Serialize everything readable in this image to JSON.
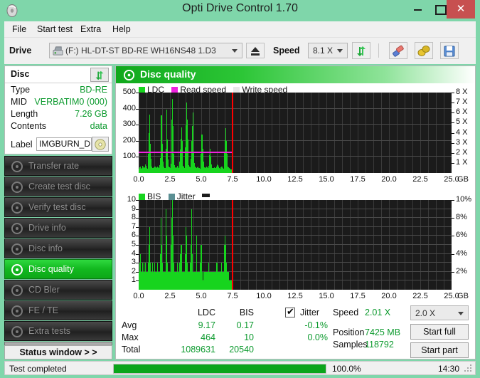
{
  "window": {
    "title": "Opti Drive Control 1.70",
    "icon": "disc-icon",
    "minimize_label": "–",
    "maximize_label": "☐",
    "close_label": "✕",
    "chrome_color": "#7fd6aa",
    "close_color": "#c75050"
  },
  "menu": {
    "items": [
      {
        "label": "File"
      },
      {
        "label": "Start test"
      },
      {
        "label": "Extra"
      },
      {
        "label": "Help"
      }
    ]
  },
  "toolbar": {
    "drive_label": "Drive",
    "drive_value": "(F:)  HL-DT-ST BD-RE  WH16NS48 1.D3",
    "drive_icon": "drive-icon",
    "eject_icon": "eject-icon",
    "speed_label": "Speed",
    "speed_value": "8.1 X",
    "refresh_icon": "refresh-icon",
    "eraser_icon": "eraser-icon",
    "bell_icon": "bell-icon",
    "save_icon": "save-icon"
  },
  "disc_panel": {
    "title": "Disc",
    "refresh_icon": "refresh-icon",
    "rows": [
      {
        "key": "Type",
        "value": "BD-RE"
      },
      {
        "key": "MID",
        "value": "VERBATIM0 (000)"
      },
      {
        "key": "Length",
        "value": "7.26 GB"
      },
      {
        "key": "Contents",
        "value": "data"
      }
    ],
    "label_key": "Label",
    "label_value": "IMGBURN_DIS",
    "label_icon": "disc-icon",
    "value_color": "#0c9a2e"
  },
  "nav": {
    "items": [
      {
        "label": "Transfer rate",
        "icon": "disc-test-icon",
        "active": false
      },
      {
        "label": "Create test disc",
        "icon": "disc-create-icon",
        "active": false
      },
      {
        "label": "Verify test disc",
        "icon": "disc-verify-icon",
        "active": false
      },
      {
        "label": "Drive info",
        "icon": "drive-info-icon",
        "active": false
      },
      {
        "label": "Disc info",
        "icon": "disc-info-icon",
        "active": false
      },
      {
        "label": "Disc quality",
        "icon": "disc-quality-icon",
        "active": true
      },
      {
        "label": "CD Bler",
        "icon": "disc-bler-icon",
        "active": false
      },
      {
        "label": "FE / TE",
        "icon": "disc-fete-icon",
        "active": false
      },
      {
        "label": "Extra tests",
        "icon": "disc-extra-icon",
        "active": false
      }
    ],
    "status_window_label": "Status window > >"
  },
  "main": {
    "title": "Disc quality",
    "title_icon": "disc-quality-icon"
  },
  "chart_data": [
    {
      "type": "bar",
      "name": "ldc-chart",
      "title": "",
      "xlabel": "GB",
      "ylabel": "LDC",
      "ylim": [
        0,
        500
      ],
      "yticks": [
        100,
        200,
        300,
        400,
        500
      ],
      "xlim": [
        0,
        25
      ],
      "xticks": [
        0.0,
        2.5,
        5.0,
        7.5,
        10.0,
        12.5,
        15.0,
        17.5,
        20.0,
        22.5,
        25.0
      ],
      "xticklabels": [
        "0.0",
        "2.5",
        "5.0",
        "7.5",
        "10.0",
        "12.5",
        "15.0",
        "17.5",
        "20.0",
        "22.5",
        "25.0"
      ],
      "x_unit_label": "GB",
      "y2label": "Speed",
      "y2lim": [
        0,
        8
      ],
      "y2ticks": [
        1,
        2,
        3,
        4,
        5,
        6,
        7,
        8
      ],
      "y2ticklabels": [
        "1 X",
        "2 X",
        "3 X",
        "4 X",
        "5 X",
        "6 X",
        "7 X",
        "8 X"
      ],
      "grid": true,
      "legend": [
        {
          "label": "LDC",
          "color": "#17d41e"
        },
        {
          "label": "Read speed",
          "color": "#ee22dd"
        },
        {
          "label": "Write speed",
          "color": "#e8e8e8"
        }
      ],
      "cursor_x": 7.42,
      "read_speed_level": 125,
      "data_end_x": 7.42,
      "values": [
        28,
        34,
        41,
        30,
        26,
        33,
        45,
        38,
        31,
        29,
        36,
        52,
        44,
        35,
        30,
        28,
        60,
        120,
        250,
        365,
        180,
        90,
        45,
        38,
        33,
        30,
        28,
        35,
        42,
        38,
        31,
        29,
        34,
        40,
        36,
        32,
        30,
        48,
        95,
        190,
        358,
        300,
        180,
        70,
        42,
        36,
        33,
        30,
        150,
        312,
        395,
        210,
        85,
        40,
        35,
        32,
        30,
        58,
        170,
        330,
        462,
        290,
        120,
        50,
        38,
        34,
        31,
        29,
        35,
        44,
        38,
        33,
        30,
        70,
        145,
        212,
        285,
        200,
        95,
        45,
        38,
        33,
        30,
        160,
        295,
        438,
        330,
        210,
        110,
        48,
        40,
        35,
        31,
        90,
        198,
        290,
        377,
        240,
        130,
        60,
        42,
        36,
        32,
        30,
        35,
        40,
        36,
        33,
        30,
        28,
        44,
        120,
        238,
        240,
        150,
        70,
        40,
        35,
        31,
        29,
        34,
        38,
        35,
        31,
        28,
        45,
        110,
        152,
        100,
        55,
        38,
        33,
        30,
        28,
        32,
        36,
        33,
        30,
        28,
        40,
        55,
        48,
        38,
        33,
        30,
        28,
        35,
        42,
        38,
        33,
        30,
        28,
        50,
        130,
        205,
        278,
        200,
        120,
        55,
        40,
        35,
        30,
        28,
        26,
        24,
        20
      ]
    },
    {
      "type": "bar",
      "name": "bis-chart",
      "title": "",
      "xlabel": "GB",
      "ylabel": "BIS",
      "ylim": [
        0,
        10
      ],
      "yticks": [
        1,
        2,
        3,
        4,
        5,
        6,
        7,
        8,
        9,
        10
      ],
      "xlim": [
        0,
        25
      ],
      "xticks": [
        0.0,
        2.5,
        5.0,
        7.5,
        10.0,
        12.5,
        15.0,
        17.5,
        20.0,
        22.5,
        25.0
      ],
      "xticklabels": [
        "0.0",
        "2.5",
        "5.0",
        "7.5",
        "10.0",
        "12.5",
        "15.0",
        "17.5",
        "20.0",
        "22.5",
        "25.0"
      ],
      "x_unit_label": "GB",
      "y2label": "Jitter",
      "y2lim": [
        0,
        10
      ],
      "y2ticks": [
        2,
        4,
        6,
        8,
        10
      ],
      "y2ticklabels": [
        "2%",
        "4%",
        "6%",
        "8%",
        "10%"
      ],
      "grid": true,
      "legend": [
        {
          "label": "BIS",
          "color": "#17d41e"
        },
        {
          "label": "Jitter",
          "color": "#5b8f93"
        }
      ],
      "cursor_x": 7.42,
      "data_end_x": 7.42,
      "values": [
        2,
        3,
        4,
        3,
        2,
        2,
        3,
        2,
        2,
        3,
        2,
        2,
        3,
        2,
        2,
        2,
        2,
        3,
        5,
        7,
        3,
        2,
        2,
        2,
        3,
        2,
        2,
        2,
        3,
        2,
        2,
        2,
        2,
        3,
        2,
        2,
        2,
        2,
        3,
        4,
        8,
        5,
        3,
        2,
        2,
        2,
        2,
        2,
        6,
        9,
        6,
        3,
        2,
        2,
        2,
        2,
        2,
        3,
        5,
        8,
        10,
        6,
        3,
        2,
        2,
        2,
        2,
        2,
        2,
        3,
        2,
        2,
        2,
        3,
        4,
        5,
        5,
        3,
        2,
        2,
        2,
        2,
        2,
        4,
        7,
        6,
        4,
        3,
        2,
        2,
        2,
        2,
        3,
        5,
        9,
        6,
        4,
        2,
        2,
        2,
        2,
        2,
        2,
        6,
        3,
        2,
        2,
        2,
        2,
        2,
        3,
        5,
        5,
        3,
        2,
        1,
        2,
        2,
        1,
        2,
        2,
        1,
        2,
        2,
        2,
        3,
        2,
        1,
        2,
        2,
        2,
        2,
        1,
        2,
        2,
        2,
        2,
        2,
        2,
        2,
        3,
        2,
        2,
        2,
        2,
        2,
        2,
        2,
        3,
        2,
        2,
        2,
        2,
        3,
        5,
        6,
        5,
        3,
        2,
        2,
        2,
        2,
        1,
        1,
        1,
        1,
        1
      ]
    }
  ],
  "stats": {
    "col_ldc": "LDC",
    "col_bis": "BIS",
    "jitter_label": "Jitter",
    "jitter_checked": true,
    "rows": [
      {
        "label": "Avg",
        "ldc": "9.17",
        "bis": "0.17",
        "jitter": "-0.1%"
      },
      {
        "label": "Max",
        "ldc": "464",
        "bis": "10",
        "jitter": "0.0%"
      },
      {
        "label": "Total",
        "ldc": "1089631",
        "bis": "20540",
        "jitter": ""
      }
    ],
    "value_color": "#0c9a2e"
  },
  "readout": {
    "speed_label": "Speed",
    "speed_value": "2.01 X",
    "position_label": "Position",
    "position_value": "7425 MB",
    "samples_label": "Samples",
    "samples_value": "118792",
    "speed_select_value": "2.0 X",
    "start_full_label": "Start full",
    "start_part_label": "Start part"
  },
  "statusbar": {
    "text": "Test completed",
    "progress_percent": "100.0%",
    "progress_value": 100,
    "time": "14:30"
  }
}
